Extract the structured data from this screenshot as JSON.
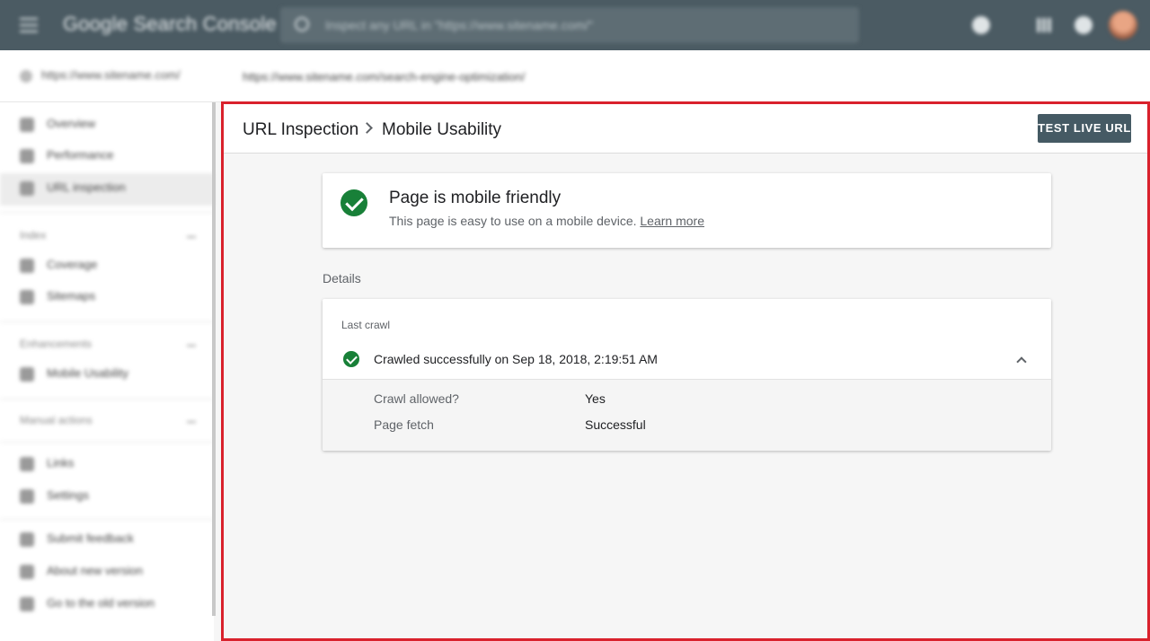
{
  "topbar": {
    "app_title": "Google Search Console",
    "search_placeholder": "Inspect any URL in \"https://www.sitename.com/\""
  },
  "property": {
    "name": "https://www.sitename.com/",
    "inspected_url": "https://www.sitename.com/search-engine-optimization/"
  },
  "sidebar": {
    "items": [
      {
        "label": "Overview",
        "icon": "home-icon"
      },
      {
        "label": "Performance",
        "icon": "trend-icon"
      },
      {
        "label": "URL inspection",
        "icon": "search-icon"
      }
    ],
    "index_section": "Index",
    "index_items": [
      {
        "label": "Coverage",
        "icon": "file-icon"
      },
      {
        "label": "Sitemaps",
        "icon": "sitemap-icon"
      }
    ],
    "enhancements_section": "Enhancements",
    "enhancement_items": [
      {
        "label": "Mobile Usability",
        "icon": "phone-icon"
      }
    ],
    "manual_section": "Manual actions",
    "other_items": [
      {
        "label": "Links",
        "icon": "people-icon"
      },
      {
        "label": "Settings",
        "icon": "gear-icon"
      },
      {
        "label": "Submit feedback",
        "icon": "feedback-icon"
      },
      {
        "label": "About new version",
        "icon": "info-icon"
      },
      {
        "label": "Go to the old version",
        "icon": "back-icon"
      }
    ]
  },
  "main": {
    "breadcrumb_parent": "URL Inspection",
    "breadcrumb_current": "Mobile Usability",
    "test_button": "TEST LIVE URL",
    "status_title": "Page is mobile friendly",
    "status_desc": "This page is easy to use on a mobile device.",
    "learn_more": "Learn more",
    "details_label": "Details",
    "last_crawl_label": "Last crawl",
    "crawl_status": "Crawled successfully on Sep 18, 2018, 2:19:51 AM",
    "rows": [
      {
        "label": "Crawl allowed?",
        "value": "Yes"
      },
      {
        "label": "Page fetch",
        "value": "Successful"
      }
    ]
  },
  "colors": {
    "topbar": "#4b5b63",
    "highlight_border": "#d9212c",
    "success_green": "#188038",
    "button_bg": "#455a64"
  }
}
